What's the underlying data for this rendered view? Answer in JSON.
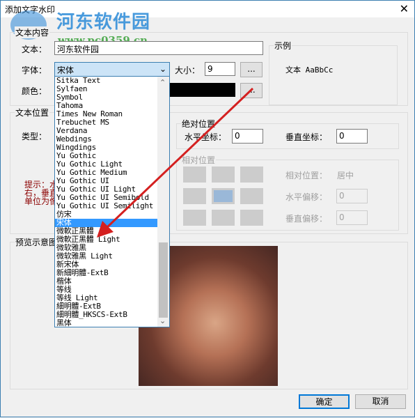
{
  "window": {
    "title": "添加文字水印",
    "close": "✕"
  },
  "watermark": {
    "brand": "河东软件园",
    "url": "www.pc0359.cn"
  },
  "text_content": {
    "group": "文本内容",
    "text_label": "文本：",
    "text_value": "河东软件园",
    "font_label": "字体：",
    "font_value": "宋体",
    "size_label": "大小：",
    "size_value": "9",
    "more": "...",
    "color_label": "颜色：",
    "color_value": "#000000"
  },
  "sample": {
    "group": "示例",
    "text": "文本 AaBbCc"
  },
  "position": {
    "group": "文本位置",
    "type_label": "类型：",
    "hint": [
      "提示：水",
      "右，垂直",
      "单位为像"
    ],
    "absolute": {
      "group": "绝对位置",
      "h_label": "水平坐标：",
      "h_value": "0",
      "v_label": "垂直坐标：",
      "v_value": "0"
    },
    "relative": {
      "group": "相对位置",
      "pos_label": "相对位置：",
      "pos_value": "居中",
      "h_label": "水平偏移：",
      "h_value": "0",
      "v_label": "垂直偏移：",
      "v_value": "0",
      "selected_cell": "center"
    }
  },
  "preview": {
    "group": "预览示意图"
  },
  "font_list": {
    "items": [
      "Sitka Text",
      "Sylfaen",
      "Symbol",
      "Tahoma",
      "Times New Roman",
      "Trebuchet MS",
      "Verdana",
      "Webdings",
      "Wingdings",
      "Yu Gothic",
      "Yu Gothic Light",
      "Yu Gothic Medium",
      "Yu Gothic UI",
      "Yu Gothic UI Light",
      "Yu Gothic UI Semibold",
      "Yu Gothic UI Semilight",
      "仿宋",
      "宋体",
      "微軟正黑體",
      "微軟正黑體 Light",
      "微软雅黑",
      "微软雅黑 Light",
      "新宋体",
      "新細明體-ExtB",
      "楷体",
      "等线",
      "等线 Light",
      "細明體-ExtB",
      "細明體_HKSCS-ExtB",
      "黑体"
    ],
    "selected": "宋体"
  },
  "buttons": {
    "ok": "确定",
    "cancel": "取消"
  },
  "colors": {
    "accent": "#3399ff",
    "arrow": "#d42020",
    "hint": "#8b0000"
  }
}
